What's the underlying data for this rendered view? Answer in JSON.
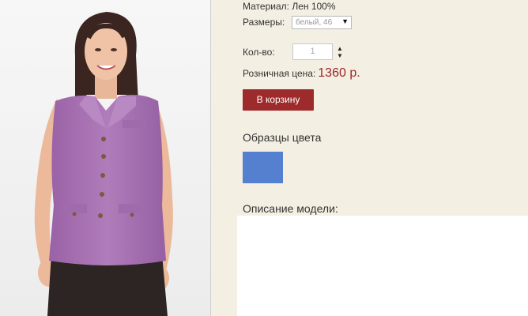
{
  "product": {
    "material_label": "Материал:",
    "material_value": "Лен 100%",
    "sizes_label": "Размеры:",
    "selected_size": "белый, 46",
    "qty_label": "Кол-во:",
    "qty_value": "1",
    "price_label": "Розничная цена:",
    "price_value": "1360 р.",
    "add_to_cart_label": "В корзину",
    "swatches_title": "Образцы цвета",
    "swatch_colors": [
      "#5580cf"
    ],
    "description_title": "Описание модели:"
  },
  "colors": {
    "page_background": "#f4efe3",
    "price": "#9e2424",
    "cart_button": "#9e2b2b",
    "blouse": "#a872b2"
  },
  "icons": {
    "size_dropdown": "triangle-down",
    "qty_stepper": "up-down-triangles"
  }
}
